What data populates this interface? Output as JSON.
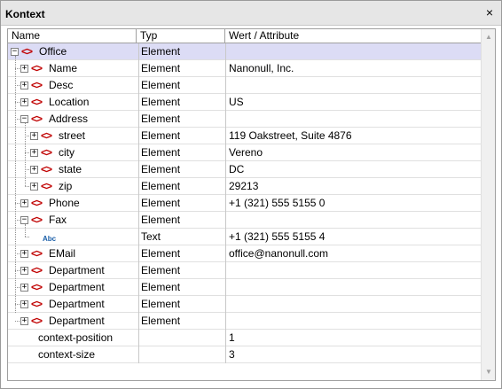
{
  "panel": {
    "title": "Kontext",
    "close_icon": "×"
  },
  "columns": {
    "name": "Name",
    "type": "Typ",
    "value": "Wert / Attribute"
  },
  "rows": [
    {
      "name": "Office",
      "type": "Element",
      "value": ""
    },
    {
      "name": "Name",
      "type": "Element",
      "value": "Nanonull, Inc."
    },
    {
      "name": "Desc",
      "type": "Element",
      "value": ""
    },
    {
      "name": "Location",
      "type": "Element",
      "value": "US"
    },
    {
      "name": "Address",
      "type": "Element",
      "value": ""
    },
    {
      "name": "street",
      "type": "Element",
      "value": "119 Oakstreet, Suite 4876"
    },
    {
      "name": "city",
      "type": "Element",
      "value": "Vereno"
    },
    {
      "name": "state",
      "type": "Element",
      "value": "DC"
    },
    {
      "name": "zip",
      "type": "Element",
      "value": "29213"
    },
    {
      "name": "Phone",
      "type": "Element",
      "value": "+1 (321) 555 5155 0"
    },
    {
      "name": "Fax",
      "type": "Element",
      "value": ""
    },
    {
      "name": "",
      "type": "Text",
      "value": "+1 (321) 555 5155 4",
      "icon": "Abc"
    },
    {
      "name": "EMail",
      "type": "Element",
      "value": "office@nanonull.com"
    },
    {
      "name": "Department",
      "type": "Element",
      "value": ""
    },
    {
      "name": "Department",
      "type": "Element",
      "value": ""
    },
    {
      "name": "Department",
      "type": "Element",
      "value": ""
    },
    {
      "name": "Department",
      "type": "Element",
      "value": ""
    },
    {
      "name": "context-position",
      "type": "",
      "value": "1"
    },
    {
      "name": "context-size",
      "type": "",
      "value": "3"
    }
  ],
  "icons": {
    "expand": "+",
    "collapse": "−",
    "element": "<>",
    "scroll_up": "▲",
    "scroll_down": "▼"
  },
  "colors": {
    "selection": "#dcdcf5",
    "element_icon": "#c00000",
    "text_icon": "#1b5fa8"
  }
}
